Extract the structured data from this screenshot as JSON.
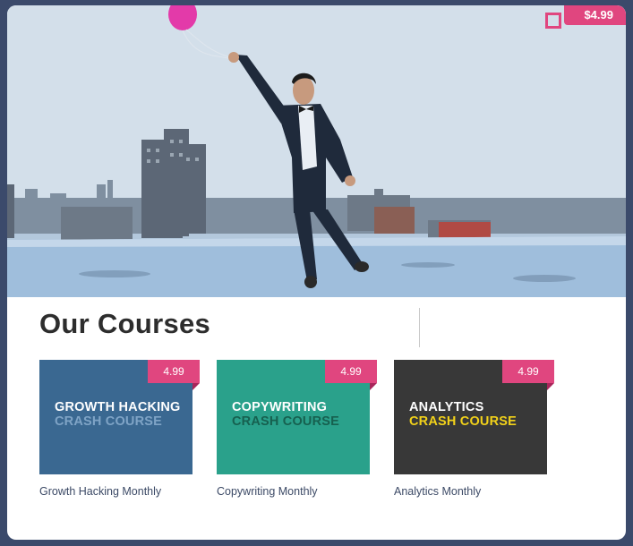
{
  "hero": {
    "price": "$4.99",
    "colors": {
      "accent": "#e0467f",
      "balloon": "#e33aa9"
    }
  },
  "section": {
    "title": "Our Courses"
  },
  "courses": [
    {
      "badge": "4.99",
      "line1": "GROWTH HACKING",
      "line2": "CRASH COURSE",
      "name": "Growth Hacking Monthly",
      "bg": "#3a6891",
      "line2_color": "#7fa4c6"
    },
    {
      "badge": "4.99",
      "line1": "COPYWRITING",
      "line2": "CRASH COURSE",
      "name": "Copywriting Monthly",
      "bg": "#2aa18b",
      "line2_color": "#16604f"
    },
    {
      "badge": "4.99",
      "line1": "ANALYTICS",
      "line2": "CRASH COURSE",
      "name": "Analytics Monthly",
      "bg": "#383838",
      "line2_color": "#f2d21a"
    }
  ]
}
